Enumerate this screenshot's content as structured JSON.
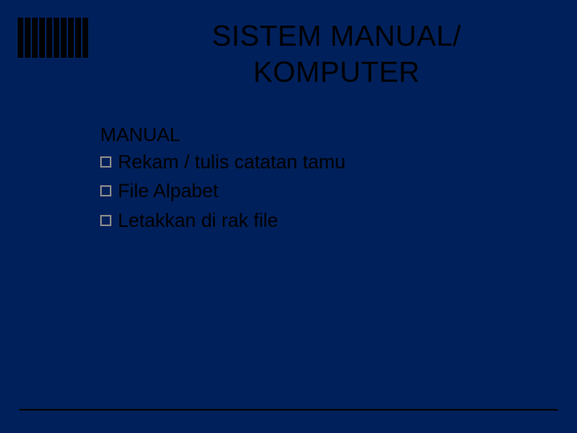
{
  "title": {
    "line1": "SISTEM MANUAL/",
    "line2": "KOMPUTER"
  },
  "section_heading": "MANUAL",
  "bullets": [
    "Rekam / tulis catatan tamu",
    "File Alpabet",
    "Letakkan di rak file"
  ]
}
